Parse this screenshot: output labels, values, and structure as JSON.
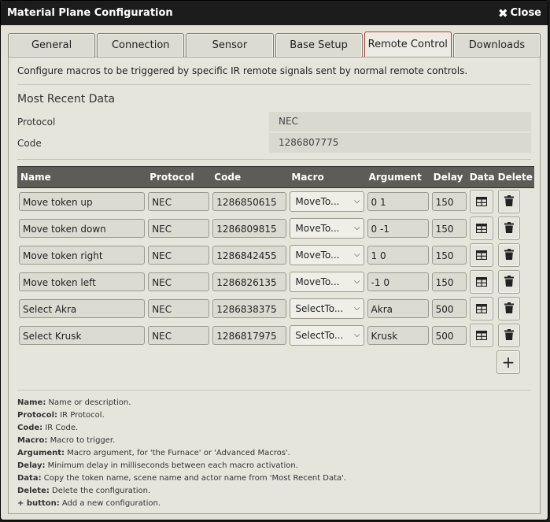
{
  "window": {
    "title": "Material Plane Configuration",
    "close_label": "Close"
  },
  "tabs": [
    {
      "label": "General",
      "active": false
    },
    {
      "label": "Connection",
      "active": false
    },
    {
      "label": "Sensor",
      "active": false
    },
    {
      "label": "Base Setup",
      "active": false
    },
    {
      "label": "Remote Control",
      "active": true
    },
    {
      "label": "Downloads",
      "active": false
    }
  ],
  "intro": "Configure macros to be triggered by specific IR remote signals sent by normal remote controls.",
  "recent": {
    "title": "Most Recent Data",
    "protocol_label": "Protocol",
    "protocol_value": "NEC",
    "code_label": "Code",
    "code_value": "1286807775"
  },
  "table": {
    "headers": {
      "name": "Name",
      "protocol": "Protocol",
      "code": "Code",
      "macro": "Macro",
      "argument": "Argument",
      "delay": "Delay",
      "data": "Data",
      "delete": "Delete"
    },
    "rows": [
      {
        "name": "Move token up",
        "protocol": "NEC",
        "code": "1286850615",
        "macro": "MoveTo...",
        "argument": "0 1",
        "delay": "150"
      },
      {
        "name": "Move token down",
        "protocol": "NEC",
        "code": "1286809815",
        "macro": "MoveTo...",
        "argument": "0 -1",
        "delay": "150"
      },
      {
        "name": "Move token right",
        "protocol": "NEC",
        "code": "1286842455",
        "macro": "MoveTo...",
        "argument": "1 0",
        "delay": "150"
      },
      {
        "name": "Move token left",
        "protocol": "NEC",
        "code": "1286826135",
        "macro": "MoveTo...",
        "argument": "-1 0",
        "delay": "150"
      },
      {
        "name": "Select Akra",
        "protocol": "NEC",
        "code": "1286838375",
        "macro": "SelectTo...",
        "argument": "Akra",
        "delay": "500"
      },
      {
        "name": "Select Krusk",
        "protocol": "NEC",
        "code": "1286817975",
        "macro": "SelectTo...",
        "argument": "Krusk",
        "delay": "500"
      }
    ]
  },
  "help": [
    {
      "term": "Name:",
      "text": " Name or description."
    },
    {
      "term": "Protocol:",
      "text": " IR Protocol."
    },
    {
      "term": "Code:",
      "text": " IR Code."
    },
    {
      "term": "Macro:",
      "text": " Macro to trigger."
    },
    {
      "term": "Argument:",
      "text": " Macro argument, for 'the Furnace' or 'Advanced Macros'."
    },
    {
      "term": "Delay:",
      "text": " Minimum delay in milliseconds between each macro activation."
    },
    {
      "term": "Data:",
      "text": " Copy the token name, scene name and actor name from 'Most Recent Data'."
    },
    {
      "term": "Delete:",
      "text": " Delete the configuration."
    },
    {
      "term": "+ button:",
      "text": " Add a new configuration."
    }
  ],
  "colors": {
    "accent_tab_border": "#c93a30",
    "header_bg": "#5d5c57",
    "titlebar_bg": "#1c1c1c"
  }
}
